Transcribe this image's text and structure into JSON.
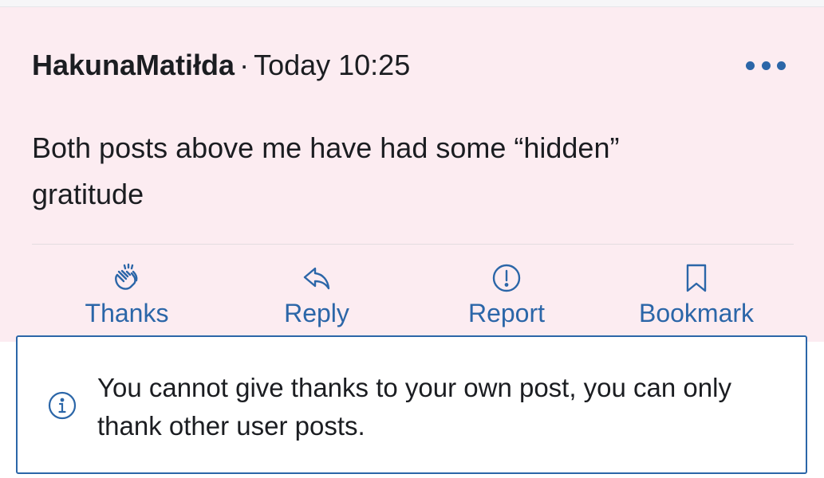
{
  "post": {
    "username": "HakunaMatiłda",
    "separator": "·",
    "timestamp": "Today 10:25",
    "body": "Both posts above me have had some “hidden” gratitude",
    "more_icon": "ellipsis-icon"
  },
  "actions": [
    {
      "label": "Thanks",
      "icon": "clapping-hands-icon"
    },
    {
      "label": "Reply",
      "icon": "reply-arrow-icon"
    },
    {
      "label": "Report",
      "icon": "alert-circle-icon"
    },
    {
      "label": "Bookmark",
      "icon": "bookmark-icon"
    }
  ],
  "toast": {
    "icon": "info-icon",
    "message": "You cannot give thanks to your own post, you can only thank other user posts."
  },
  "colors": {
    "accent": "#2b66a8",
    "post_background": "#fcecf1",
    "text": "#1b1d21"
  }
}
